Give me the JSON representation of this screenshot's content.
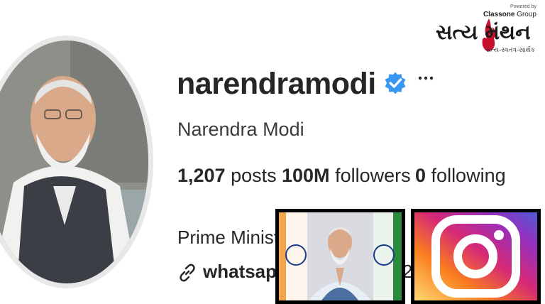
{
  "profile": {
    "username": "narendramodi",
    "full_name": "Narendra Modi",
    "posts_count": "1,207",
    "posts_label": "posts",
    "followers_count": "100M",
    "followers_label": "followers",
    "following_count": "0",
    "following_label": "following",
    "bio": "Prime Ministe",
    "link_text": "whatsapp",
    "trailing_text": "2"
  },
  "brand": {
    "powered_by": "Powered by",
    "group_bold": "Classone",
    "group_rest": " Group",
    "name": "સત્ય મંથન",
    "tagline": "સત્ય-સ્વતંત્ર-સાર્થક"
  },
  "icons": {
    "verified": "verified-badge-icon",
    "more": "more-options-icon",
    "link": "link-icon",
    "instagram": "instagram-logo-icon"
  },
  "colors": {
    "verified_blue": "#3897f0",
    "instagram_gradient": [
      "#feda75",
      "#fa7e1e",
      "#d62976",
      "#962fbf",
      "#4f5bd5"
    ]
  }
}
